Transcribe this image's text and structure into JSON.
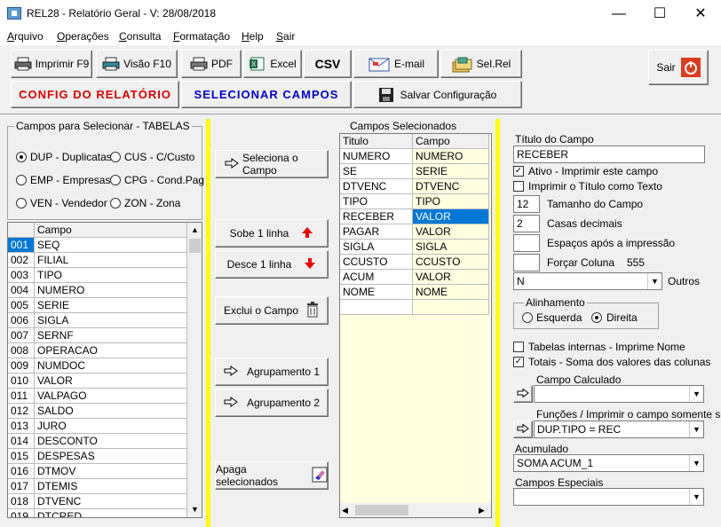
{
  "window": {
    "title": "REL28 - Relatório Geral - V: 28/08/2018",
    "minimize": "—",
    "maximize": "☐",
    "close": "✕"
  },
  "menu": [
    "Arquivo",
    "Operações",
    "Consulta",
    "Formatação",
    "Help",
    "Sair"
  ],
  "toolbar": {
    "print": "Imprimir F9",
    "preview": "Visão F10",
    "pdf": "PDF",
    "excel": "Excel",
    "csv": "CSV",
    "email": "E-mail",
    "selrel": "Sel.Rel",
    "exit": "Sair",
    "config": "CONFIG  DO  RELATÓRIO",
    "select_fields": "SELECIONAR  CAMPOS",
    "save_config": "Salvar Configuração"
  },
  "tables_group": {
    "label": "Campos para Selecionar  - TABELAS",
    "options": [
      {
        "label": "DUP - Duplicatas",
        "selected": true
      },
      {
        "label": "CUS - C/Custo",
        "selected": false
      },
      {
        "label": "EMP - Empresas",
        "selected": false
      },
      {
        "label": "CPG - Cond.Pag",
        "selected": false
      },
      {
        "label": "VEN - Vendedor",
        "selected": false
      },
      {
        "label": "ZON - Zona",
        "selected": false
      }
    ]
  },
  "fields_grid": {
    "header": "Campo",
    "rows": [
      [
        "001",
        "SEQ"
      ],
      [
        "002",
        "FILIAL"
      ],
      [
        "003",
        "TIPO"
      ],
      [
        "004",
        "NUMERO"
      ],
      [
        "005",
        "SERIE"
      ],
      [
        "006",
        "SIGLA"
      ],
      [
        "007",
        "SERNF"
      ],
      [
        "008",
        "OPERACAO"
      ],
      [
        "009",
        "NUMDOC"
      ],
      [
        "010",
        "VALOR"
      ],
      [
        "011",
        "VALPAGO"
      ],
      [
        "012",
        "SALDO"
      ],
      [
        "013",
        "JURO"
      ],
      [
        "014",
        "DESCONTO"
      ],
      [
        "015",
        "DESPESAS"
      ],
      [
        "016",
        "DTMOV"
      ],
      [
        "017",
        "DTEMIS"
      ],
      [
        "018",
        "DTVENC"
      ],
      [
        "019",
        "DTCRED"
      ]
    ]
  },
  "actions": {
    "select_field": "Seleciona o Campo",
    "move_up": "Sobe 1 linha",
    "move_down": "Desce 1 linha",
    "delete_field": "Exclui o Campo",
    "group1": "Agrupamento 1",
    "group2": "Agrupamento 2",
    "delete_selected": "Apaga selecionados"
  },
  "selected_fields": {
    "label": "Campos Selecionados",
    "headers": [
      "Titulo",
      "Campo"
    ],
    "rows": [
      [
        "NUMERO",
        "NUMERO"
      ],
      [
        "SE",
        "SERIE"
      ],
      [
        "DTVENC",
        "DTVENC"
      ],
      [
        "TIPO",
        "TIPO"
      ],
      [
        "RECEBER",
        "VALOR"
      ],
      [
        "PAGAR",
        "VALOR"
      ],
      [
        "SIGLA",
        "SIGLA"
      ],
      [
        "CCUSTO",
        "CCUSTO"
      ],
      [
        "ACUM",
        "VALOR"
      ],
      [
        "NOME",
        "NOME"
      ],
      [
        "",
        ""
      ]
    ]
  },
  "props": {
    "title_label": "Título do Campo",
    "title_value": "RECEBER",
    "active_label": "Ativo - Imprimir este campo",
    "print_title_label": "Imprimir o Título como Texto",
    "size_value": "12",
    "size_label": "Tamanho do Campo",
    "decimals_value": "2",
    "decimals_label": "Casas decimais",
    "spaces_value": "",
    "spaces_label": "Espaços após a impressão",
    "force_value": "",
    "force_label": "Forçar Coluna",
    "force_number": "555",
    "others_value": "N",
    "others_label": "Outros",
    "align_label": "Alinhamento",
    "align_left": "Esquerda",
    "align_right": "Direita",
    "internal_label": "Tabelas internas - Imprime Nome",
    "totals_label": "Totais - Soma dos valores das colunas",
    "calc_label": "Campo Calculado",
    "calc_value": "",
    "func_label": "Funções / Imprimir o campo somente se",
    "func_value": "DUP.TIPO = REC",
    "acum_label": "Acumulado",
    "acum_value": "SOMA ACUM_1",
    "special_label": "Campos Especiais",
    "special_value": ""
  }
}
